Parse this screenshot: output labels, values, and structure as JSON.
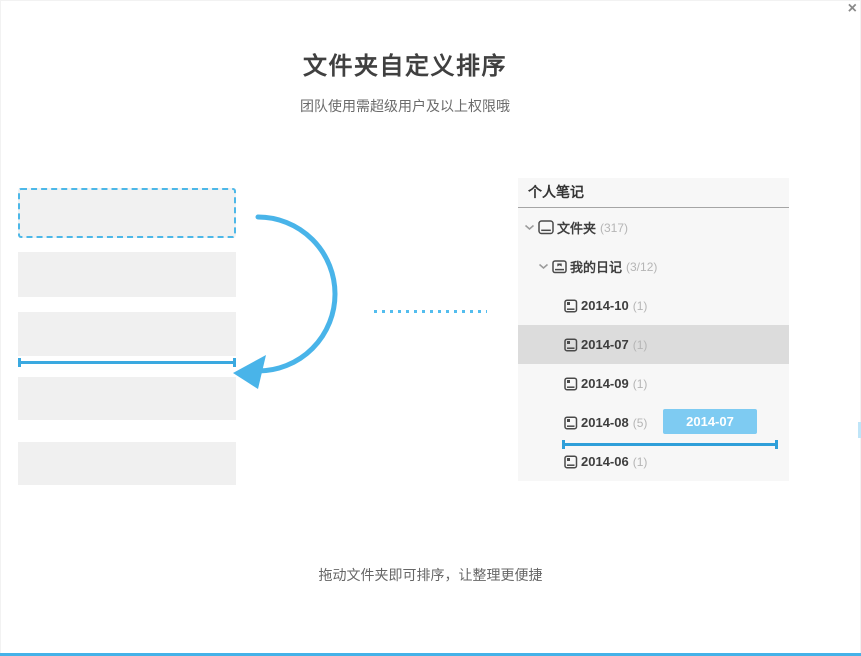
{
  "modal": {
    "title": "文件夹自定义排序",
    "subtitle": "团队使用需超级用户及以上权限哦",
    "caption": "拖动文件夹即可排序，让整理更便捷",
    "close_glyph": "×"
  },
  "panel": {
    "title": "个人笔记",
    "drag_badge": "2014-07",
    "tree": [
      {
        "label": "文件夹",
        "count": "(317)"
      },
      {
        "label": "我的日记",
        "count": "(3/12)"
      },
      {
        "label": "2014-10",
        "count": "(1)"
      },
      {
        "label": "2014-07",
        "count": "(1)"
      },
      {
        "label": "2014-09",
        "count": "(1)"
      },
      {
        "label": "2014-08",
        "count": "(5)"
      },
      {
        "label": "2014-06",
        "count": "(1)"
      }
    ]
  },
  "colors": {
    "accent_blue": "#45b2e8",
    "drop_line_blue": "#3aa9e0",
    "badge_blue": "#7ecbf2",
    "bar_gray": "#f0f0f0",
    "panel_gray": "#f7f7f7",
    "highlight_gray": "#dcdcdc"
  }
}
